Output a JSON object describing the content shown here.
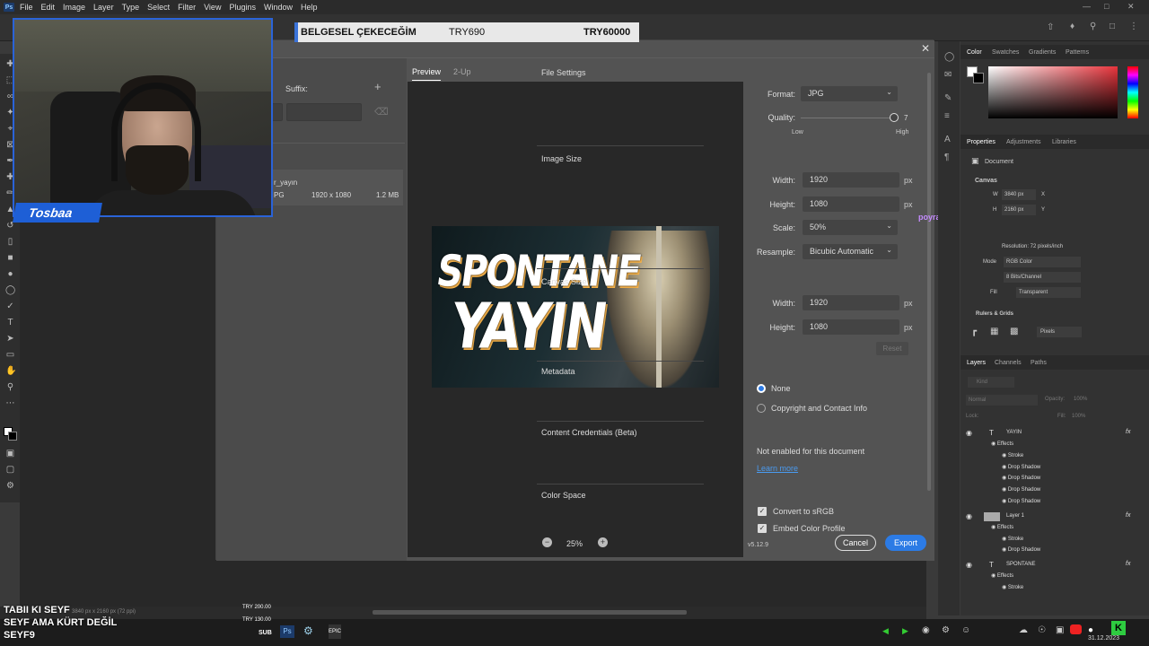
{
  "menu": [
    "File",
    "Edit",
    "Image",
    "Layer",
    "Type",
    "Select",
    "Filter",
    "View",
    "Plugins",
    "Window",
    "Help"
  ],
  "app_logo": "Ps",
  "webcam": {
    "streamer_name": "Tosbaa"
  },
  "donation": {
    "name": "BELGESEL ÇEKECEĞİM",
    "amount": "TRY690",
    "goal": "TRY60000"
  },
  "chat_overlay": {
    "user": "poyraz809",
    "message": "sa"
  },
  "dialog": {
    "suffix_label": "Suffix:",
    "file_name": "r_yayın",
    "file_type": "PG",
    "file_dimensions": "1920 x 1080",
    "file_size": "1.2 MB",
    "tabs": [
      "Preview",
      "2-Up"
    ],
    "zoom": "25%",
    "version": "v5.12.9",
    "cancel_label": "Cancel",
    "export_label": "Export",
    "thumbnail": {
      "line1": "SPONTANE",
      "line2": "YAYIN"
    },
    "file_settings": {
      "title": "File Settings",
      "format_label": "Format:",
      "format_value": "JPG",
      "quality_label": "Quality:",
      "quality_value": "7",
      "quality_low": "Low",
      "quality_high": "High"
    },
    "image_size": {
      "title": "Image Size",
      "width_label": "Width:",
      "width_value": "1920",
      "height_label": "Height:",
      "height_value": "1080",
      "scale_label": "Scale:",
      "scale_value": "50%",
      "resample_label": "Resample:",
      "resample_value": "Bicubic Automatic",
      "unit": "px"
    },
    "canvas_size": {
      "title": "Canvas Size",
      "width_label": "Width:",
      "width_value": "1920",
      "height_label": "Height:",
      "height_value": "1080",
      "reset_label": "Reset",
      "unit": "px"
    },
    "metadata": {
      "title": "Metadata",
      "option_none": "None",
      "option_copyright": "Copyright and Contact Info"
    },
    "content_credentials": {
      "title": "Content Credentials (Beta)",
      "status": "Not enabled for this document",
      "learn_more": "Learn more"
    },
    "color_space": {
      "title": "Color Space",
      "convert_label": "Convert to sRGB",
      "embed_label": "Embed Color Profile"
    }
  },
  "right_panel": {
    "color_tabs": [
      "Color",
      "Swatches",
      "Gradients",
      "Patterns"
    ],
    "prop_tabs": [
      "Properties",
      "Adjustments",
      "Libraries"
    ],
    "document_label": "Document",
    "canvas_label": "Canvas",
    "w_label": "W",
    "w_value": "3840 px",
    "h_label": "H",
    "h_value": "2160 px",
    "x_label": "X",
    "y_label": "Y",
    "resolution": "Resolution: 72 pixels/inch",
    "mode_label": "Mode",
    "mode_value": "RGB Color",
    "bits_value": "8 Bits/Channel",
    "fill_label": "Fill",
    "fill_value": "Transparent",
    "rulers_label": "Rulers & Grids",
    "units_value": "Pixels",
    "layer_tabs": [
      "Layers",
      "Channels",
      "Paths"
    ],
    "kind_label": "Kind",
    "blend_mode": "Normal",
    "opacity_label": "Opacity:",
    "opacity_value": "100%",
    "lock_label": "Lock:",
    "fill2_label": "Fill:",
    "fill2_value": "100%",
    "layers": [
      {
        "name": "YAYIN",
        "type": "text",
        "effects": [
          "Effects",
          "Stroke",
          "Drop Shadow",
          "Drop Shadow",
          "Drop Shadow",
          "Drop Shadow"
        ]
      },
      {
        "name": "Layer 1",
        "type": "image",
        "effects": [
          "Effects",
          "Stroke",
          "Drop Shadow"
        ]
      },
      {
        "name": "SPONTANE",
        "type": "text",
        "effects": [
          "Effects",
          "Stroke"
        ]
      }
    ]
  },
  "status_bar": {
    "doc_info": "3840 px x 2160 px (72 ppi)"
  },
  "stream_overlay": {
    "line1": "TABII KI SEYF",
    "line2": "SEYF AMA KÜRT DEĞİL",
    "line3": "SEYF9",
    "amount1": "TRY 200.00",
    "amount2": "TRY 130.00",
    "sub_label": "SUB"
  },
  "taskbar": {
    "date": "31.12.2023"
  }
}
